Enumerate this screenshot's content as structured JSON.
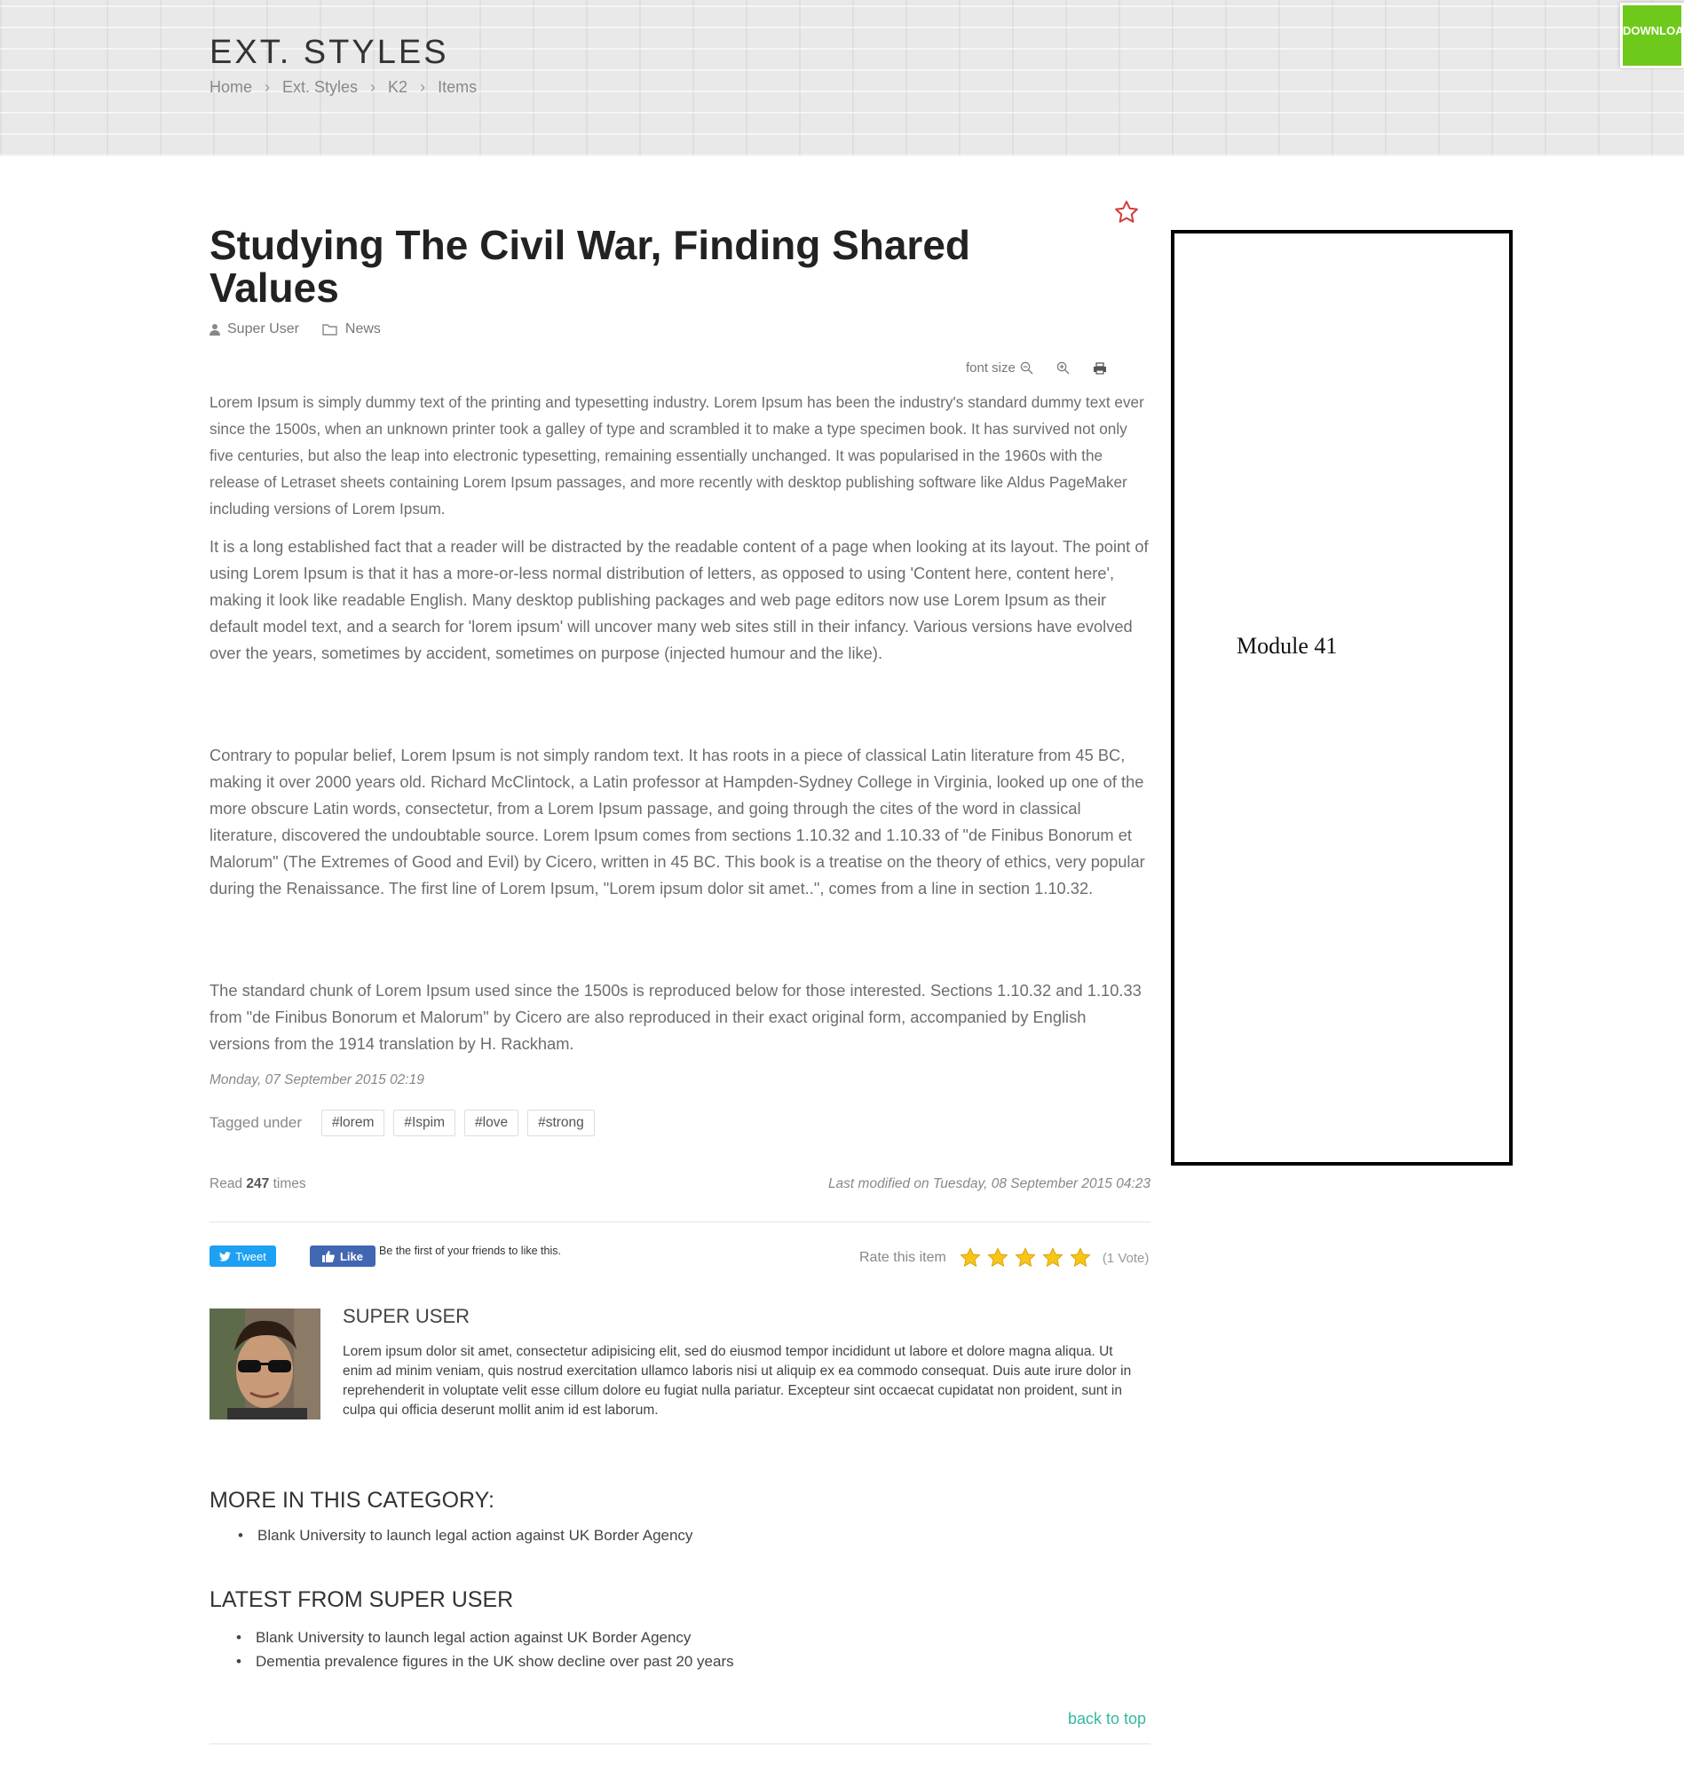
{
  "header": {
    "title": "EXT. STYLES",
    "breadcrumb": [
      "Home",
      "Ext. Styles",
      "K2",
      "Items"
    ],
    "download_button": "DOWNLOAD NOW"
  },
  "article": {
    "title": "Studying The Civil War, Finding Shared Values",
    "author": "Super User",
    "category": "News",
    "tools": {
      "font_size_label": "font size"
    },
    "paragraphs": [
      "Lorem Ipsum is simply dummy text of the printing and typesetting industry. Lorem Ipsum has been the industry's standard dummy text ever since the 1500s, when an unknown printer took a galley of type and scrambled it to make a type specimen book. It has survived not only five centuries, but also the leap into electronic typesetting, remaining essentially unchanged. It was popularised in the 1960s with the release of Letraset sheets containing Lorem Ipsum passages, and more recently with desktop publishing software like Aldus PageMaker including versions of Lorem Ipsum.",
      "It is a long established fact that a reader will be distracted by the readable content of a page when looking at its layout. The point of using Lorem Ipsum is that it has a more-or-less normal distribution of letters, as opposed to using 'Content here, content here', making it look like readable English. Many desktop publishing packages and web page editors now use Lorem Ipsum as their default model text, and a search for 'lorem ipsum' will uncover many web sites still in their infancy. Various versions have evolved over the years, sometimes by accident, sometimes on purpose (injected humour and the like).",
      "Contrary to popular belief, Lorem Ipsum is not simply random text. It has roots in a piece of classical Latin literature from 45 BC, making it over 2000 years old. Richard McClintock, a Latin professor at Hampden-Sydney College in Virginia, looked up one of the more obscure Latin words, consectetur, from a Lorem Ipsum passage, and going through the cites of the word in classical literature, discovered the undoubtable source. Lorem Ipsum comes from sections 1.10.32 and 1.10.33 of \"de Finibus Bonorum et Malorum\" (The Extremes of Good and Evil) by Cicero, written in 45 BC. This book is a treatise on the theory of ethics, very popular during the Renaissance. The first line of Lorem Ipsum, \"Lorem ipsum dolor sit amet..\", comes from a line in section 1.10.32.",
      "The standard chunk of Lorem Ipsum used since the 1500s is reproduced below for those interested. Sections 1.10.32 and 1.10.33 from \"de Finibus Bonorum et Malorum\" by Cicero are also reproduced in their exact original form, accompanied by English versions from the 1914 translation by H. Rackham."
    ],
    "date": "Monday, 07 September 2015 02:19",
    "tagged_label": "Tagged under",
    "tags": [
      "#lorem",
      "#Ispim",
      "#love",
      "#strong"
    ],
    "read_prefix": "Read",
    "read_count": "247",
    "read_suffix": "times",
    "last_modified": "Last modified on Tuesday, 08 September 2015 04:23"
  },
  "social": {
    "tweet_label": "Tweet",
    "like_label": "Like",
    "like_text": "Be the first of your friends to like this."
  },
  "rating": {
    "label": "Rate this item",
    "stars": 5,
    "votes": "(1 Vote)"
  },
  "author_box": {
    "name": "SUPER USER",
    "bio": "Lorem ipsum dolor sit amet, consectetur adipisicing elit, sed do eiusmod tempor incididunt ut labore et dolore magna aliqua. Ut enim ad minim veniam, quis nostrud exercitation ullamco laboris nisi ut aliquip ex ea commodo consequat. Duis aute irure dolor in reprehenderit in voluptate velit esse cillum dolore eu fugiat nulla pariatur. Excepteur sint occaecat cupidatat non proident, sunt in culpa qui officia deserunt mollit anim id est laborum."
  },
  "more_category": {
    "title": "MORE IN THIS CATEGORY:",
    "items": [
      "Blank University to launch legal action against UK Border Agency"
    ]
  },
  "latest_user": {
    "title": "LATEST FROM SUPER USER",
    "items": [
      "Blank University to launch legal action against UK Border Agency",
      "Dementia prevalence figures in the UK show decline over past 20 years"
    ]
  },
  "back_to_top": "back to top",
  "sidebar_module": {
    "label": "Module 41"
  },
  "colors": {
    "accent_green": "#6fc91a",
    "link_teal": "#35b8a0",
    "star_yellow": "#f5c518"
  }
}
